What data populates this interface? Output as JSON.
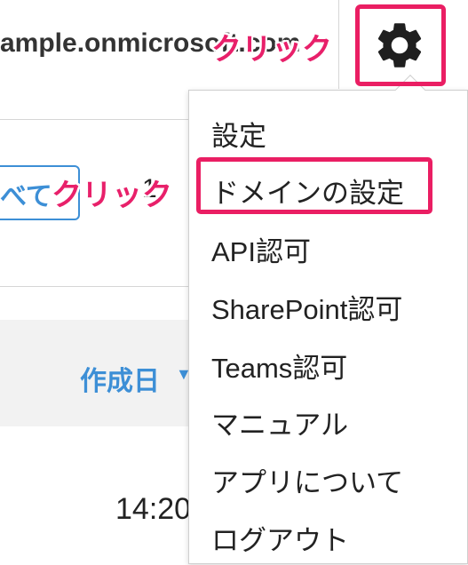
{
  "header": {
    "tenant_domain": "ample.onmicrosoft.com"
  },
  "annotations": {
    "click_gear": "クリック",
    "click_domain": "クリック"
  },
  "toolbar": {
    "filter_all_label": "べて",
    "partial_text": "1"
  },
  "table": {
    "columns": {
      "created_at": "作成日"
    },
    "rows": [
      {
        "time": "14:20"
      }
    ]
  },
  "settings_menu": {
    "items": [
      {
        "label": "設定"
      },
      {
        "label": "ドメインの設定"
      },
      {
        "label": "API認可"
      },
      {
        "label": "SharePoint認可"
      },
      {
        "label": "Teams認可"
      },
      {
        "label": "マニュアル"
      },
      {
        "label": "アプリについて"
      },
      {
        "label": "ログアウト"
      }
    ]
  },
  "icons": {
    "settings": "gear-icon",
    "sort": "sort-desc-icon"
  },
  "colors": {
    "highlight": "#ea1e63",
    "accent": "#3d8fd6"
  }
}
